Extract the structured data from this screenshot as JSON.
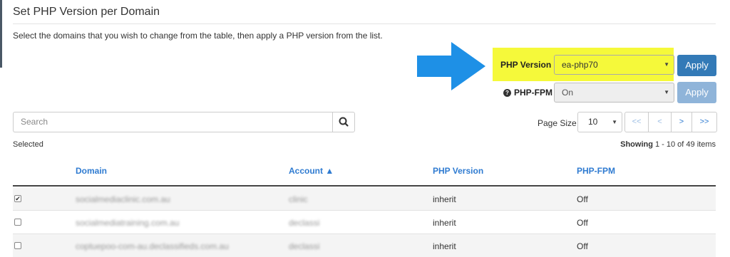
{
  "title": "Set PHP Version per Domain",
  "description": "Select the domains that you wish to change from the table, then apply a PHP version from the list.",
  "php_version": {
    "label": "PHP Version",
    "selected": "ea-php70",
    "apply_label": "Apply"
  },
  "php_fpm": {
    "label": "PHP-FPM",
    "selected": "On",
    "apply_label": "Apply"
  },
  "search": {
    "placeholder": "Search"
  },
  "pagination": {
    "page_size_label": "Page Size",
    "page_size": "10",
    "first": "<<",
    "prev": "<",
    "next": ">",
    "last": ">>"
  },
  "selected_label": "Selected",
  "showing": {
    "prefix": "Showing",
    "range": "1 - 10 of 49 items"
  },
  "table": {
    "headers": {
      "domain": "Domain",
      "account": "Account ▲",
      "php_version": "PHP Version",
      "php_fpm": "PHP-FPM"
    },
    "rows": [
      {
        "checked": true,
        "domain": "socialmediaclinic.com.au",
        "account": "clinic",
        "php_version": "inherit",
        "php_fpm": "Off"
      },
      {
        "checked": false,
        "domain": "socialmediatraining.com.au",
        "account": "declassi",
        "php_version": "inherit",
        "php_fpm": "Off"
      },
      {
        "checked": false,
        "domain": "coptuepoo-com-au.declassifieds.com.au",
        "account": "declassi",
        "php_version": "inherit",
        "php_fpm": "Off"
      }
    ]
  },
  "colors": {
    "highlight": "#f5f93a",
    "primary": "#337ab7",
    "arrow": "#1e90e6",
    "link": "#2f7bd1"
  }
}
